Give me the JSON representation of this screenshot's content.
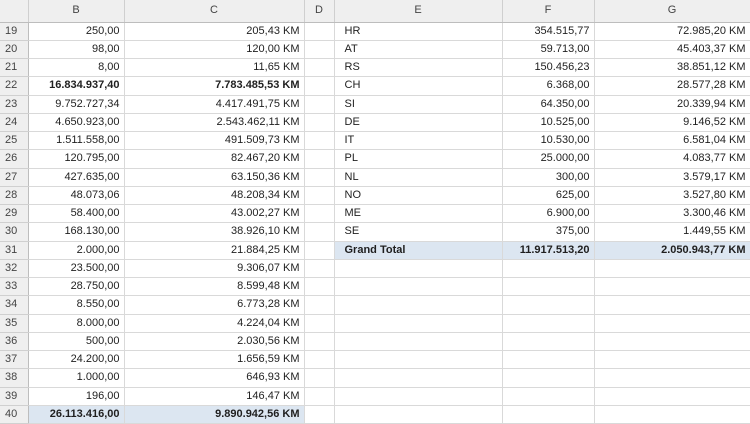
{
  "columns": [
    "B",
    "C",
    "D",
    "E",
    "F",
    "G"
  ],
  "rows": [
    {
      "n": "19",
      "b": "250,00",
      "c": "205,43 KM",
      "e": "HR",
      "f": "354.515,77",
      "g": "72.985,20 KM"
    },
    {
      "n": "20",
      "b": "98,00",
      "c": "120,00 KM",
      "e": "AT",
      "f": "59.713,00",
      "g": "45.403,37 KM"
    },
    {
      "n": "21",
      "b": "8,00",
      "c": "11,65 KM",
      "e": "RS",
      "f": "150.456,23",
      "g": "38.851,12 KM"
    },
    {
      "n": "22",
      "b": "16.834.937,40",
      "c": "7.783.485,53 KM",
      "e": "CH",
      "f": "6.368,00",
      "g": "28.577,28 KM"
    },
    {
      "n": "23",
      "b": "9.752.727,34",
      "c": "4.417.491,75 KM",
      "e": "SI",
      "f": "64.350,00",
      "g": "20.339,94 KM"
    },
    {
      "n": "24",
      "b": "4.650.923,00",
      "c": "2.543.462,11 KM",
      "e": "DE",
      "f": "10.525,00",
      "g": "9.146,52 KM"
    },
    {
      "n": "25",
      "b": "1.511.558,00",
      "c": "491.509,73 KM",
      "e": "IT",
      "f": "10.530,00",
      "g": "6.581,04 KM"
    },
    {
      "n": "26",
      "b": "120.795,00",
      "c": "82.467,20 KM",
      "e": "PL",
      "f": "25.000,00",
      "g": "4.083,77 KM"
    },
    {
      "n": "27",
      "b": "427.635,00",
      "c": "63.150,36 KM",
      "e": "NL",
      "f": "300,00",
      "g": "3.579,17 KM"
    },
    {
      "n": "28",
      "b": "48.073,06",
      "c": "48.208,34 KM",
      "e": "NO",
      "f": "625,00",
      "g": "3.527,80 KM"
    },
    {
      "n": "29",
      "b": "58.400,00",
      "c": "43.002,27 KM",
      "e": "ME",
      "f": "6.900,00",
      "g": "3.300,46 KM"
    },
    {
      "n": "30",
      "b": "168.130,00",
      "c": "38.926,10 KM",
      "e": "SE",
      "f": "375,00",
      "g": "1.449,55 KM"
    },
    {
      "n": "31",
      "b": "2.000,00",
      "c": "21.884,25 KM",
      "e": "Grand Total",
      "f": "11.917.513,20",
      "g": "2.050.943,77 KM"
    },
    {
      "n": "32",
      "b": "23.500,00",
      "c": "9.306,07 KM",
      "e": "",
      "f": "",
      "g": ""
    },
    {
      "n": "33",
      "b": "28.750,00",
      "c": "8.599,48 KM",
      "e": "",
      "f": "",
      "g": ""
    },
    {
      "n": "34",
      "b": "8.550,00",
      "c": "6.773,28 KM",
      "e": "",
      "f": "",
      "g": ""
    },
    {
      "n": "35",
      "b": "8.000,00",
      "c": "4.224,04 KM",
      "e": "",
      "f": "",
      "g": ""
    },
    {
      "n": "36",
      "b": "500,00",
      "c": "2.030,56 KM",
      "e": "",
      "f": "",
      "g": ""
    },
    {
      "n": "37",
      "b": "24.200,00",
      "c": "1.656,59 KM",
      "e": "",
      "f": "",
      "g": ""
    },
    {
      "n": "38",
      "b": "1.000,00",
      "c": "646,93 KM",
      "e": "",
      "f": "",
      "g": ""
    },
    {
      "n": "39",
      "b": "196,00",
      "c": "146,47 KM",
      "e": "",
      "f": "",
      "g": ""
    },
    {
      "n": "40",
      "b": "26.113.416,00",
      "c": "9.890.942,56 KM",
      "e": "",
      "f": "",
      "g": ""
    }
  ],
  "colors": {
    "header_bg": "#efefef",
    "highlight": "#dce6f1",
    "gridline": "#d9d9d9"
  }
}
